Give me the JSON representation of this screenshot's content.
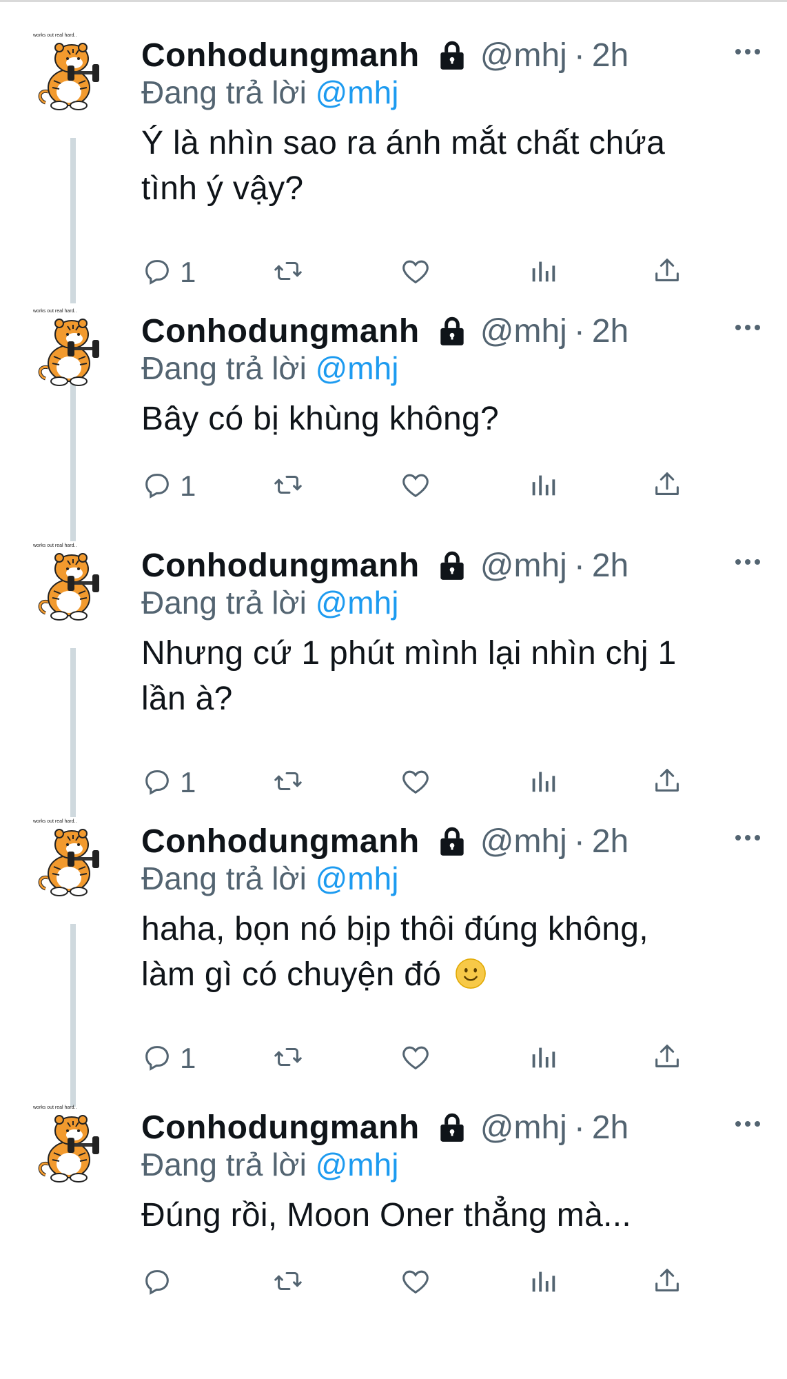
{
  "tweets": [
    {
      "author_name": "Conhodungmanh",
      "handle": "@mhj",
      "separator": "·",
      "time": "2h",
      "replying_prefix": "Đang trả lời",
      "replying_to": "@mhj",
      "lines": [
        "Ý là nhìn sao ra ánh mắt chất chứa",
        "tình ý vậy?"
      ],
      "reply_count": "1",
      "avatar_caption": "works out real hard.."
    },
    {
      "author_name": "Conhodungmanh",
      "handle": "@mhj",
      "separator": "·",
      "time": "2h",
      "replying_prefix": "Đang trả lời",
      "replying_to": "@mhj",
      "lines": [
        "Bây có bị khùng không?"
      ],
      "reply_count": "1",
      "avatar_caption": "works out real hard.."
    },
    {
      "author_name": "Conhodungmanh",
      "handle": "@mhj",
      "separator": "·",
      "time": "2h",
      "replying_prefix": "Đang trả lời",
      "replying_to": "@mhj",
      "lines": [
        "Nhưng cứ 1 phút mình lại nhìn chj 1",
        "lần à?"
      ],
      "reply_count": "1",
      "avatar_caption": "works out real hard.."
    },
    {
      "author_name": "Conhodungmanh",
      "handle": "@mhj",
      "separator": "·",
      "time": "2h",
      "replying_prefix": "Đang trả lời",
      "replying_to": "@mhj",
      "lines": [
        "haha, bọn nó bịp thôi đúng không,",
        "làm gì có chuyện đó"
      ],
      "emoji": "slightly-smiling-face",
      "reply_count": "1",
      "avatar_caption": "works out real hard.."
    },
    {
      "author_name": "Conhodungmanh",
      "handle": "@mhj",
      "separator": "·",
      "time": "2h",
      "replying_prefix": "Đang trả lời",
      "replying_to": "@mhj",
      "lines": [
        "Đúng rồi, Moon Oner thẳng mà..."
      ],
      "reply_count": "",
      "avatar_caption": "works out real hard.."
    }
  ],
  "icons": {
    "reply": "reply-icon",
    "retweet": "retweet-icon",
    "like": "heart-icon",
    "views": "analytics-icon",
    "share": "share-icon",
    "protected": "lock-icon",
    "more": "more-icon"
  },
  "colors": {
    "text": "#0f1419",
    "secondary": "#536471",
    "mention": "#1d9bf0",
    "thread_line": "#cfd9de"
  }
}
